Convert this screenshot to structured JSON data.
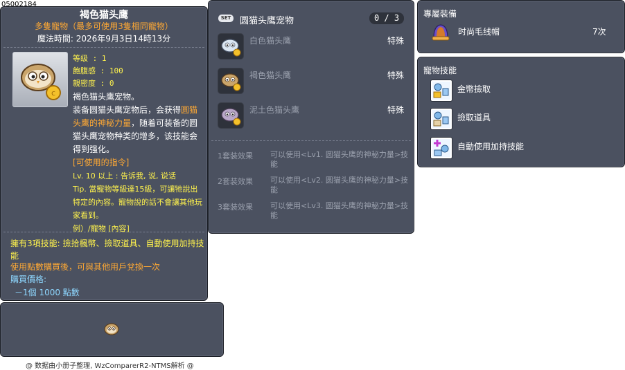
{
  "item_id": "05002184",
  "item": {
    "name": "褐色猫头鹰",
    "subtitle": "多隻寵物（最多可使用3隻相同寵物）",
    "magic_time": "魔法時間: 2026年9月3日14時13分",
    "stats": {
      "level": "等级 : 1",
      "fullness": "飽腹感 : 100",
      "closeness": "親密度 : 0"
    },
    "desc_line1": "褐色猫头鹰宠物。",
    "desc_line2_pre": "装备圆猫头鹰宠物后，会获得",
    "desc_line2_hl": "圆猫头鹰的神秘力量",
    "desc_line2_post": "，随着可装备的圆猫头鹰宠物种类的增多，该技能会得到强化。",
    "cmd_header": "[可使用的指令]",
    "cmd_line1": "Lv. 10 以上 : 告诉我, 说, 说话",
    "cmd_tip": "Tip. 當寵物等級達15級，可讓牠說出特定的內容。寵物說的話不會讓其他玩家看到。",
    "cmd_example": "例）/寵物 [內容]",
    "skills_note": "擁有3項技能: 撿拾楓幣、撿取道具、自動使用加持技能",
    "exchange_note": "使用點數購買後，可與其他用戶兌換一次",
    "price_label": "購買價格:",
    "price_value": "－1個 1000 點數"
  },
  "credit": "@ 数据由小册子整理, WzComparerR2-NTMS解析 @",
  "set": {
    "badge": "SET",
    "title": "圆猫头鹰宠物",
    "count": "0 / 3",
    "items": [
      {
        "name": "白色猫头鹰",
        "type": "特殊"
      },
      {
        "name": "褐色猫头鹰",
        "type": "特殊"
      },
      {
        "name": "泥土色猫头鹰",
        "type": "特殊"
      }
    ],
    "effects": [
      {
        "label": "1套装效果",
        "text": "可以使用<Lv1. 圆猫头鹰的神秘力量>技能"
      },
      {
        "label": "2套装效果",
        "text": "可以使用<Lv2. 圆猫头鹰的神秘力量>技能"
      },
      {
        "label": "3套装效果",
        "text": "可以使用<Lv3. 圆猫头鹰的神秘力量>技能"
      }
    ]
  },
  "equip": {
    "title": "專屬裝備",
    "item_name": "时尚毛线帽",
    "item_count": "7次"
  },
  "skills": {
    "title": "寵物技能",
    "items": [
      {
        "name": "金幣撿取"
      },
      {
        "name": "撿取道具"
      },
      {
        "name": "自動使用加持技能"
      }
    ]
  },
  "colors": {
    "panel_bg": "#4b5160",
    "accent_orange": "#ffa934",
    "accent_yellow": "#fff34d",
    "price_blue": "#8ed7ff"
  }
}
